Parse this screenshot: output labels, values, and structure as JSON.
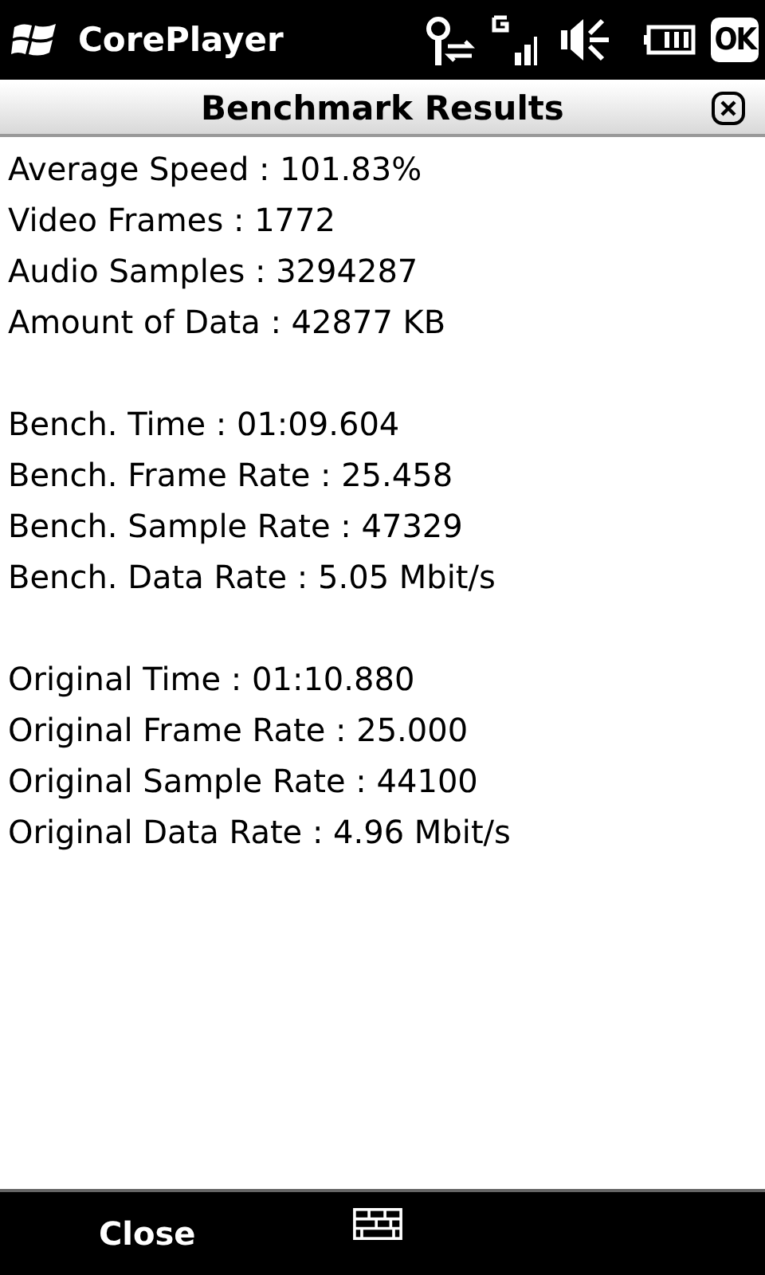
{
  "status_bar": {
    "app_title": "CorePlayer",
    "ok_label": "OK"
  },
  "dialog": {
    "title": "Benchmark Results"
  },
  "groups": [
    [
      "Average Speed : 101.83%",
      "Video Frames : 1772",
      "Audio Samples : 3294287",
      "Amount of Data : 42877 KB"
    ],
    [
      "Bench. Time : 01:09.604",
      "Bench. Frame Rate : 25.458",
      "Bench. Sample Rate : 47329",
      "Bench. Data Rate : 5.05 Mbit/s"
    ],
    [
      "Original Time : 01:10.880",
      "Original Frame Rate : 25.000",
      "Original Sample Rate : 44100",
      "Original Data Rate : 4.96 Mbit/s"
    ]
  ],
  "soft_keys": {
    "left": "Close"
  }
}
